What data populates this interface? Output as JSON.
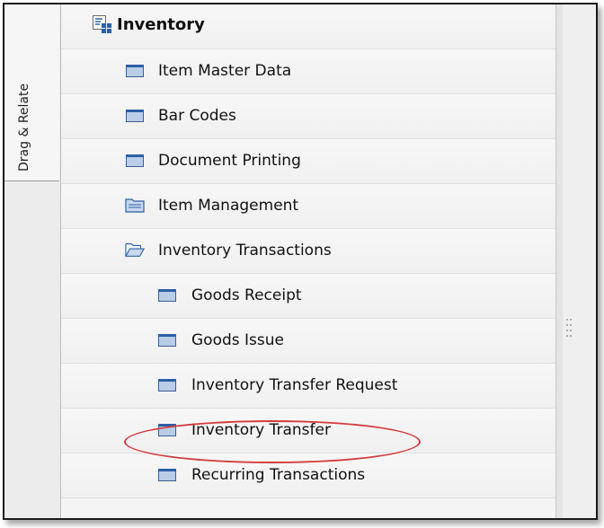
{
  "side_tab": {
    "label": "Drag & Relate"
  },
  "tree": {
    "root": {
      "label": "Inventory",
      "icon": "module-icon"
    },
    "items": [
      {
        "label": "Item Master Data",
        "icon": "form-icon",
        "level": 1
      },
      {
        "label": "Bar Codes",
        "icon": "form-icon",
        "level": 1
      },
      {
        "label": "Document Printing",
        "icon": "form-icon",
        "level": 1
      },
      {
        "label": "Item Management",
        "icon": "folder-closed-icon",
        "level": 1
      },
      {
        "label": "Inventory Transactions",
        "icon": "folder-open-icon",
        "level": 1,
        "expanded": true
      },
      {
        "label": "Goods Receipt",
        "icon": "form-icon",
        "level": 2
      },
      {
        "label": "Goods Issue",
        "icon": "form-icon",
        "level": 2
      },
      {
        "label": "Inventory Transfer Request",
        "icon": "form-icon",
        "level": 2
      },
      {
        "label": "Inventory Transfer",
        "icon": "form-icon",
        "level": 2,
        "annotated": true
      },
      {
        "label": "Recurring Transactions",
        "icon": "form-icon",
        "level": 2
      }
    ]
  },
  "colors": {
    "annotation": "#d43c3c",
    "form_icon_fill": "#b9cde6",
    "form_icon_border": "#2b5fa8"
  }
}
